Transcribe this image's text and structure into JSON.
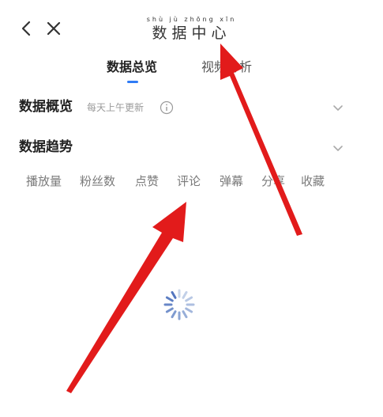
{
  "header": {
    "title": "数据中心",
    "title_pinyin": "shù jù zhōng xīn",
    "back_icon": "chevron-left-icon",
    "close_icon": "close-icon"
  },
  "tabs": [
    {
      "label": "数据总览",
      "active": true
    },
    {
      "label": "视频分析",
      "active": false
    }
  ],
  "sections": {
    "overview": {
      "title": "数据概览",
      "note": "每天上午更新",
      "info_icon": "info-icon",
      "chevron_icon": "chevron-down-icon"
    },
    "trend": {
      "title": "数据趋势",
      "chevron_icon": "chevron-down-icon"
    }
  },
  "metrics": [
    "播放量",
    "粉丝数",
    "点赞",
    "评论",
    "弹幕",
    "分享",
    "收藏"
  ],
  "colors": {
    "accent": "#2f7bf5",
    "annotation_arrow": "#e21b1b",
    "muted_text": "#9a9a9a"
  },
  "loading": {
    "icon": "loading-spinner-icon"
  }
}
